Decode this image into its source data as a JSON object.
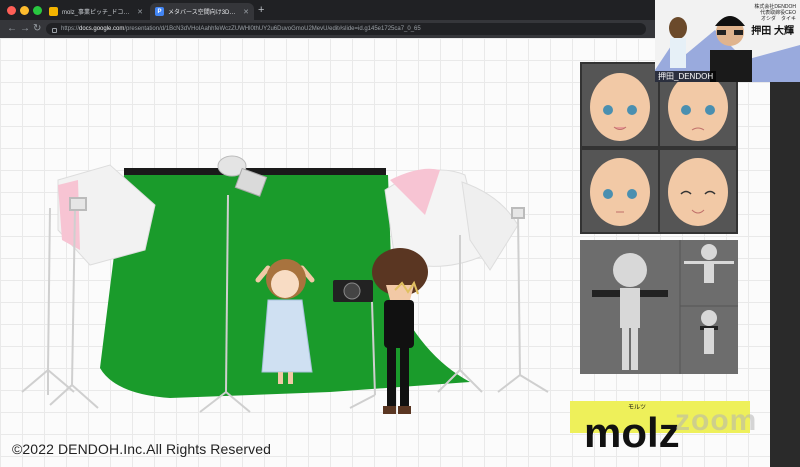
{
  "browser": {
    "tabs": [
      {
        "favicon": "google-slides-icon",
        "title": "molz_事業ピッチ_ドコモベンチャ…"
      },
      {
        "favicon": "google-docs-icon",
        "title": "メタバース空間向け3Dアバター…"
      }
    ],
    "new_tab_label": "+",
    "url_prefix": "https://",
    "url_host": "docs.google.com",
    "url_path": "/presentation/d/1BcN3dVHoIAahhfeWczZUWHl0thUY2u6DuvoGmoU2MevU/edit#slide=id.g145e1725ca7_0_65"
  },
  "video": {
    "company": "株式会社DENDOH",
    "role": "代表取締役CEO",
    "furigana": "オシダ　タイキ",
    "presenter_name": "押田 大輝",
    "participant_label": "押田_DENDOH"
  },
  "slide": {
    "copyright": "©2022 DENDOH.Inc.All Rights Reserved",
    "logo_text": "molz",
    "logo_ruby": "モルツ",
    "watermark": "zoom"
  },
  "colors": {
    "green_screen": "#1a9b2b",
    "logo_bg": "#eef05a",
    "logo_text": "#111111",
    "skin": "#f2c9a6",
    "panel_dark": "#333333",
    "mesh_panel": "#6d6d6d"
  }
}
